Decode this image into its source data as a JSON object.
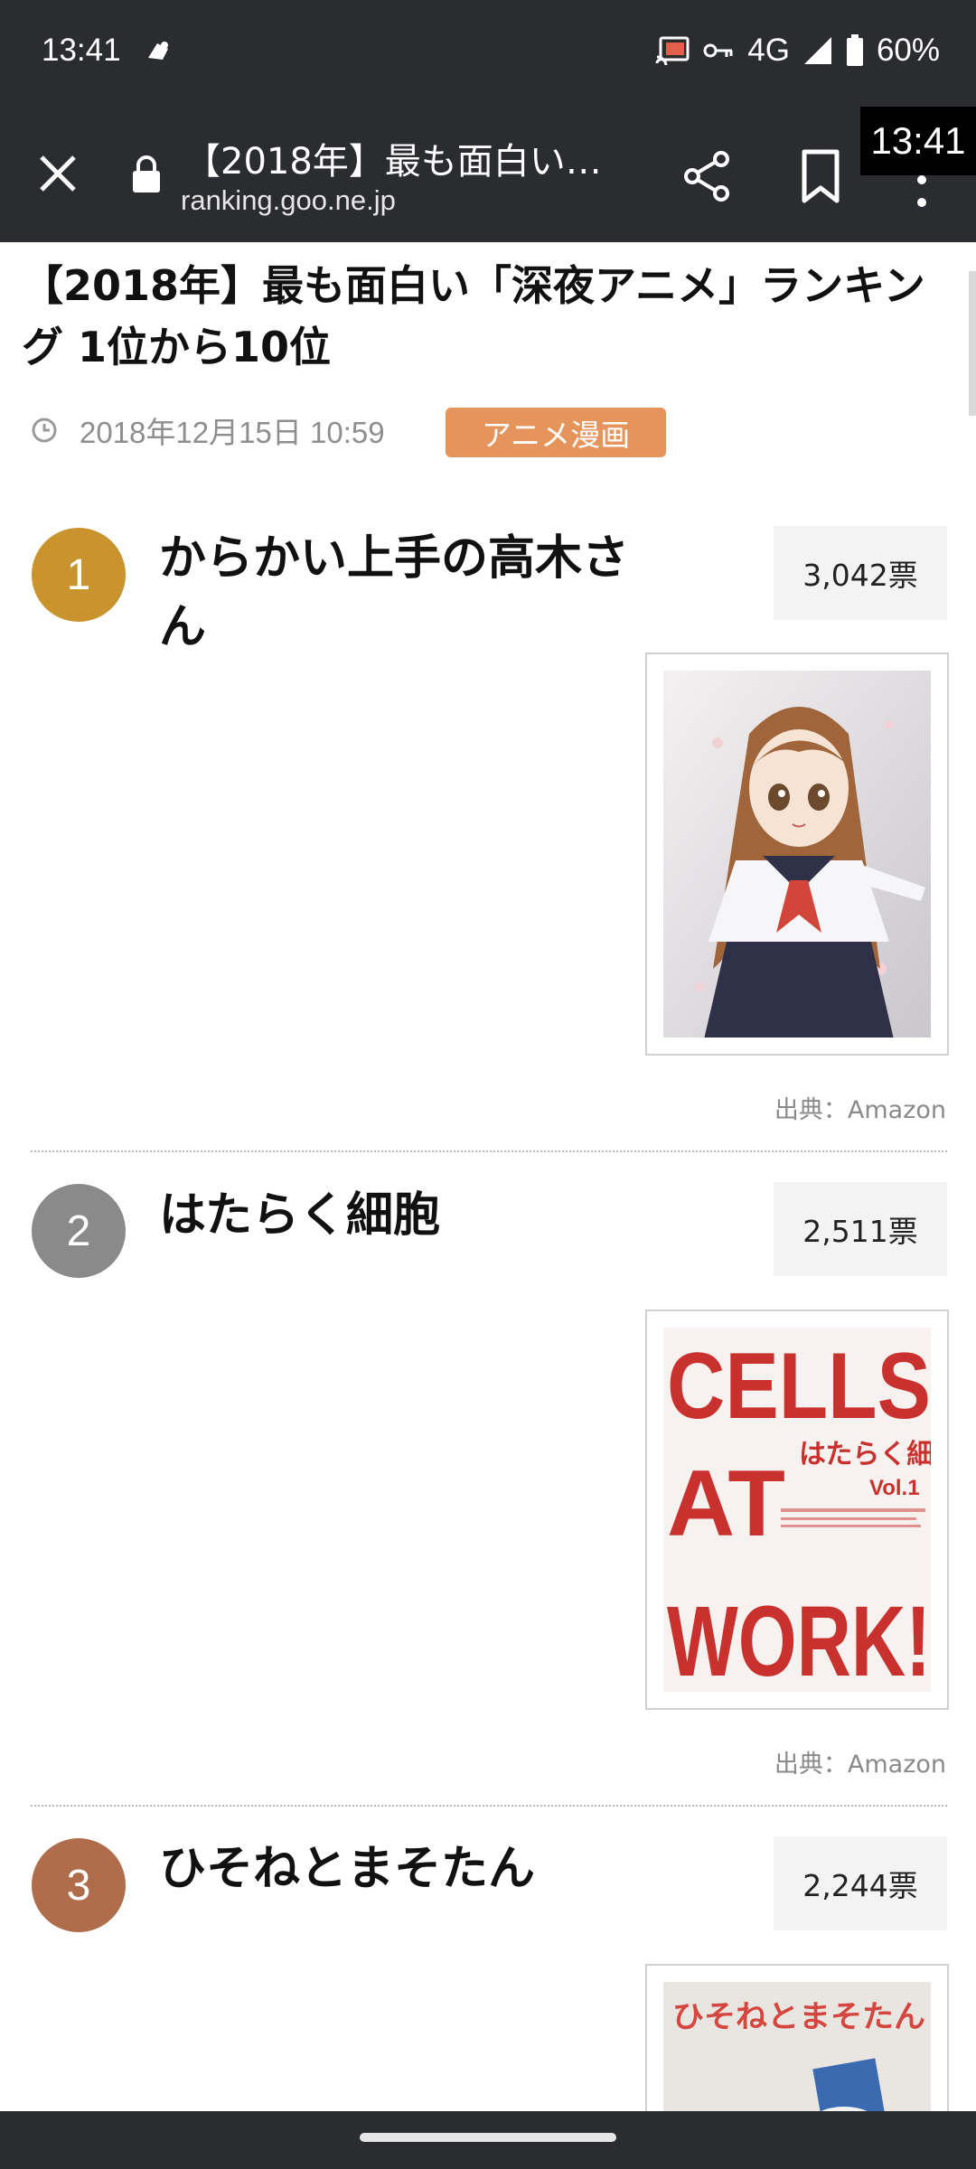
{
  "status_bar": {
    "time": "13:41",
    "network": "4G",
    "battery": "60%",
    "icons": [
      "notification-icon",
      "cast-icon",
      "vpn-key-icon",
      "signal-icon",
      "battery-icon"
    ]
  },
  "toolbar": {
    "title": "【2018年】最も面白い…",
    "url": "ranking.goo.ne.jp",
    "icons": [
      "close-icon",
      "lock-icon",
      "share-icon",
      "bookmark-icon",
      "more-icon"
    ]
  },
  "time_overlay": "13:41",
  "article": {
    "title": "【2018年】最も面白い「深夜アニメ」ランキング 1位から10位",
    "date": "2018年12月15日 10:59",
    "category": "アニメ漫画"
  },
  "rankings": [
    {
      "rank": "1",
      "name": "からかい上手の高木さん",
      "votes": "3,042票",
      "source": "出典：Amazon",
      "badge_color": "#c9932e"
    },
    {
      "rank": "2",
      "name": "はたらく細胞",
      "votes": "2,511票",
      "source": "出典：Amazon",
      "badge_color": "#8a8a8a",
      "cover_text": {
        "line1": "CELLS",
        "line2": "AT",
        "line3": "WORK!",
        "jp": "はたらく細胞",
        "vol": "Vol.1"
      }
    },
    {
      "rank": "3",
      "name": "ひそねとまそたん",
      "votes": "2,244票",
      "badge_color": "#b06d4b",
      "cover_text": {
        "title": "ひそねとまそたん"
      }
    }
  ]
}
